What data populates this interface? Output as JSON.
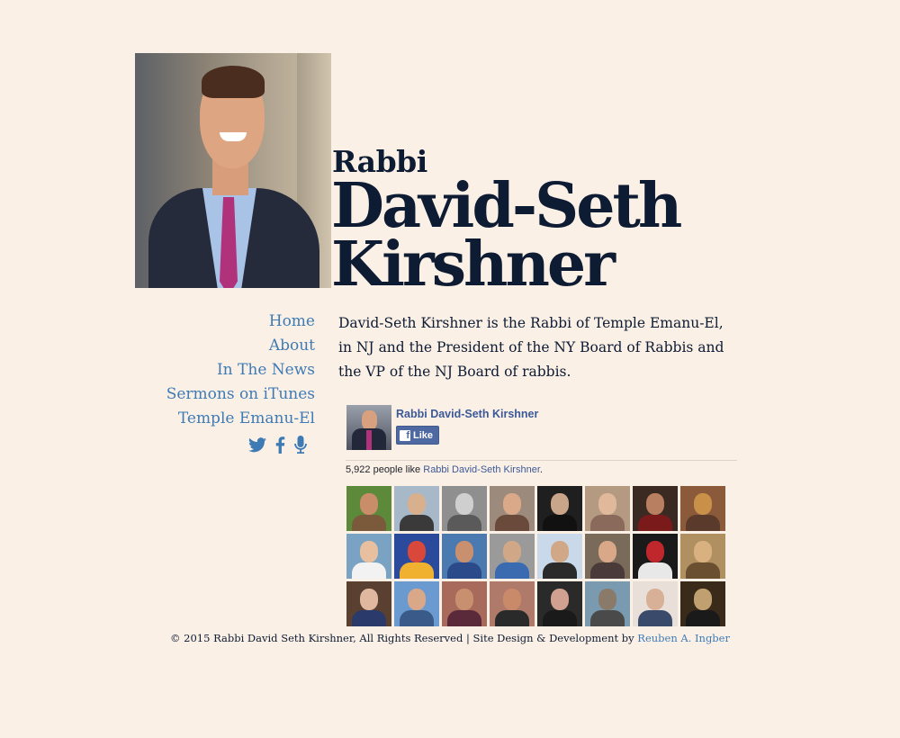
{
  "header": {
    "title_prefix": "Rabbi",
    "name_line1": "David-Seth",
    "name_line2": "Kirshner"
  },
  "nav": {
    "items": [
      {
        "label": "Home"
      },
      {
        "label": "About"
      },
      {
        "label": "In The News"
      },
      {
        "label": "Sermons on iTunes"
      },
      {
        "label": "Temple Emanu-El"
      }
    ],
    "social_icons": [
      "twitter-icon",
      "facebook-icon",
      "microphone-icon"
    ]
  },
  "bio": "David-Seth Kirshner is the Rabbi of Temple Emanu-El, in NJ and the President of the NY Board of Rabbis and the VP of the NJ Board of rabbis.",
  "facebook_widget": {
    "page_name": "Rabbi David-Seth Kirshner",
    "like_label": "Like",
    "count_text": "5,922 people like",
    "count_link": "Rabbi David-Seth Kirshner",
    "count_suffix": ".",
    "fans_shown": 24,
    "brand_color": "#3b5998"
  },
  "footer": {
    "text": "© 2015 Rabbi David Seth Kirshner, All Rights Reserved | Site Design & Development by",
    "link_label": "Reuben A. Ingber"
  },
  "colors": {
    "background": "#fbf0e6",
    "heading": "#0d1b33",
    "link": "#3e7bb5"
  }
}
